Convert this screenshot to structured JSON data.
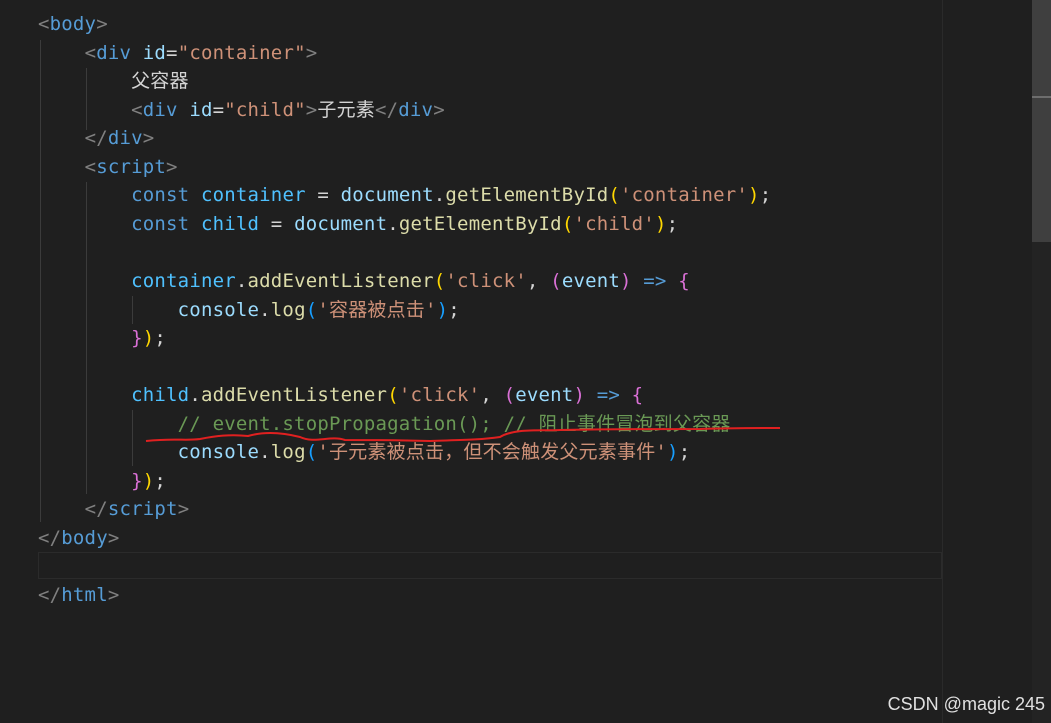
{
  "editor": {
    "lines": [
      {
        "tokens": [
          {
            "c": "punc",
            "t": "<"
          },
          {
            "c": "tag",
            "t": "body"
          },
          {
            "c": "punc",
            "t": ">"
          }
        ]
      },
      {
        "tokens": [
          {
            "c": "txt",
            "t": "    "
          },
          {
            "c": "punc",
            "t": "<"
          },
          {
            "c": "tag",
            "t": "div"
          },
          {
            "c": "txt",
            "t": " "
          },
          {
            "c": "attr",
            "t": "id"
          },
          {
            "c": "txt",
            "t": "="
          },
          {
            "c": "str",
            "t": "\"container\""
          },
          {
            "c": "punc",
            "t": ">"
          }
        ]
      },
      {
        "tokens": [
          {
            "c": "txt",
            "t": "        父容器"
          }
        ]
      },
      {
        "tokens": [
          {
            "c": "txt",
            "t": "        "
          },
          {
            "c": "punc",
            "t": "<"
          },
          {
            "c": "tag",
            "t": "div"
          },
          {
            "c": "txt",
            "t": " "
          },
          {
            "c": "attr",
            "t": "id"
          },
          {
            "c": "txt",
            "t": "="
          },
          {
            "c": "str",
            "t": "\"child\""
          },
          {
            "c": "punc",
            "t": ">"
          },
          {
            "c": "txt",
            "t": "子元素"
          },
          {
            "c": "punc",
            "t": "</"
          },
          {
            "c": "tag",
            "t": "div"
          },
          {
            "c": "punc",
            "t": ">"
          }
        ]
      },
      {
        "tokens": [
          {
            "c": "txt",
            "t": "    "
          },
          {
            "c": "punc",
            "t": "</"
          },
          {
            "c": "tag",
            "t": "div"
          },
          {
            "c": "punc",
            "t": ">"
          }
        ]
      },
      {
        "tokens": [
          {
            "c": "txt",
            "t": "    "
          },
          {
            "c": "punc",
            "t": "<"
          },
          {
            "c": "tag",
            "t": "script"
          },
          {
            "c": "punc",
            "t": ">"
          }
        ]
      },
      {
        "tokens": [
          {
            "c": "txt",
            "t": "        "
          },
          {
            "c": "kw",
            "t": "const"
          },
          {
            "c": "txt",
            "t": " "
          },
          {
            "c": "var",
            "t": "container"
          },
          {
            "c": "op",
            "t": " = "
          },
          {
            "c": "obj",
            "t": "document"
          },
          {
            "c": "op",
            "t": "."
          },
          {
            "c": "fn",
            "t": "getElementById"
          },
          {
            "c": "br1",
            "t": "("
          },
          {
            "c": "str",
            "t": "'container'"
          },
          {
            "c": "br1",
            "t": ")"
          },
          {
            "c": "op",
            "t": ";"
          }
        ]
      },
      {
        "tokens": [
          {
            "c": "txt",
            "t": "        "
          },
          {
            "c": "kw",
            "t": "const"
          },
          {
            "c": "txt",
            "t": " "
          },
          {
            "c": "var",
            "t": "child"
          },
          {
            "c": "op",
            "t": " = "
          },
          {
            "c": "obj",
            "t": "document"
          },
          {
            "c": "op",
            "t": "."
          },
          {
            "c": "fn",
            "t": "getElementById"
          },
          {
            "c": "br1",
            "t": "("
          },
          {
            "c": "str",
            "t": "'child'"
          },
          {
            "c": "br1",
            "t": ")"
          },
          {
            "c": "op",
            "t": ";"
          }
        ]
      },
      {
        "tokens": [
          {
            "c": "txt",
            "t": ""
          }
        ]
      },
      {
        "tokens": [
          {
            "c": "txt",
            "t": "        "
          },
          {
            "c": "var",
            "t": "container"
          },
          {
            "c": "op",
            "t": "."
          },
          {
            "c": "fn",
            "t": "addEventListener"
          },
          {
            "c": "br1",
            "t": "("
          },
          {
            "c": "str",
            "t": "'click'"
          },
          {
            "c": "op",
            "t": ", "
          },
          {
            "c": "br2",
            "t": "("
          },
          {
            "c": "param",
            "t": "event"
          },
          {
            "c": "br2",
            "t": ")"
          },
          {
            "c": "op",
            "t": " "
          },
          {
            "c": "arrow",
            "t": "=>"
          },
          {
            "c": "op",
            "t": " "
          },
          {
            "c": "br2",
            "t": "{"
          }
        ]
      },
      {
        "tokens": [
          {
            "c": "txt",
            "t": "            "
          },
          {
            "c": "obj",
            "t": "console"
          },
          {
            "c": "op",
            "t": "."
          },
          {
            "c": "fn",
            "t": "log"
          },
          {
            "c": "br3",
            "t": "("
          },
          {
            "c": "str",
            "t": "'容器被点击'"
          },
          {
            "c": "br3",
            "t": ")"
          },
          {
            "c": "op",
            "t": ";"
          }
        ]
      },
      {
        "tokens": [
          {
            "c": "txt",
            "t": "        "
          },
          {
            "c": "br2",
            "t": "}"
          },
          {
            "c": "br1",
            "t": ")"
          },
          {
            "c": "op",
            "t": ";"
          }
        ]
      },
      {
        "tokens": [
          {
            "c": "txt",
            "t": ""
          }
        ]
      },
      {
        "tokens": [
          {
            "c": "txt",
            "t": "        "
          },
          {
            "c": "var",
            "t": "child"
          },
          {
            "c": "op",
            "t": "."
          },
          {
            "c": "fn",
            "t": "addEventListener"
          },
          {
            "c": "br1",
            "t": "("
          },
          {
            "c": "str",
            "t": "'click'"
          },
          {
            "c": "op",
            "t": ", "
          },
          {
            "c": "br2",
            "t": "("
          },
          {
            "c": "param",
            "t": "event"
          },
          {
            "c": "br2",
            "t": ")"
          },
          {
            "c": "op",
            "t": " "
          },
          {
            "c": "arrow",
            "t": "=>"
          },
          {
            "c": "op",
            "t": " "
          },
          {
            "c": "br2",
            "t": "{"
          }
        ]
      },
      {
        "tokens": [
          {
            "c": "txt",
            "t": "            "
          },
          {
            "c": "comment",
            "t": "// event.stopPropagation(); // 阻止事件冒泡到父容器"
          }
        ]
      },
      {
        "tokens": [
          {
            "c": "txt",
            "t": "            "
          },
          {
            "c": "obj",
            "t": "console"
          },
          {
            "c": "op",
            "t": "."
          },
          {
            "c": "fn",
            "t": "log"
          },
          {
            "c": "br3",
            "t": "("
          },
          {
            "c": "str",
            "t": "'子元素被点击，但不会触发父元素事件'"
          },
          {
            "c": "br3",
            "t": ")"
          },
          {
            "c": "op",
            "t": ";"
          }
        ]
      },
      {
        "tokens": [
          {
            "c": "txt",
            "t": "        "
          },
          {
            "c": "br2",
            "t": "}"
          },
          {
            "c": "br1",
            "t": ")"
          },
          {
            "c": "op",
            "t": ";"
          }
        ]
      },
      {
        "tokens": [
          {
            "c": "txt",
            "t": "    "
          },
          {
            "c": "punc",
            "t": "</"
          },
          {
            "c": "tag",
            "t": "script"
          },
          {
            "c": "punc",
            "t": ">"
          }
        ]
      },
      {
        "tokens": [
          {
            "c": "punc",
            "t": "</"
          },
          {
            "c": "tag",
            "t": "body"
          },
          {
            "c": "punc",
            "t": ">"
          }
        ]
      },
      {
        "tokens": [
          {
            "c": "txt",
            "t": ""
          }
        ]
      },
      {
        "tokens": [
          {
            "c": "punc",
            "t": "</"
          },
          {
            "c": "tag",
            "t": "html"
          },
          {
            "c": "punc",
            "t": ">"
          }
        ]
      }
    ]
  },
  "annotation": {
    "color": "#e02020"
  },
  "watermark": {
    "text": "CSDN @magic 245"
  },
  "colors": {
    "background": "#1f1f1f",
    "tag": "#569cd6",
    "string": "#ce9178",
    "attribute": "#9cdcfe",
    "function": "#dcdcaa",
    "comment": "#6a9955",
    "variable": "#4fc1ff",
    "bracket_gold": "#ffd700",
    "bracket_purple": "#da70d6",
    "bracket_blue": "#179fff"
  }
}
